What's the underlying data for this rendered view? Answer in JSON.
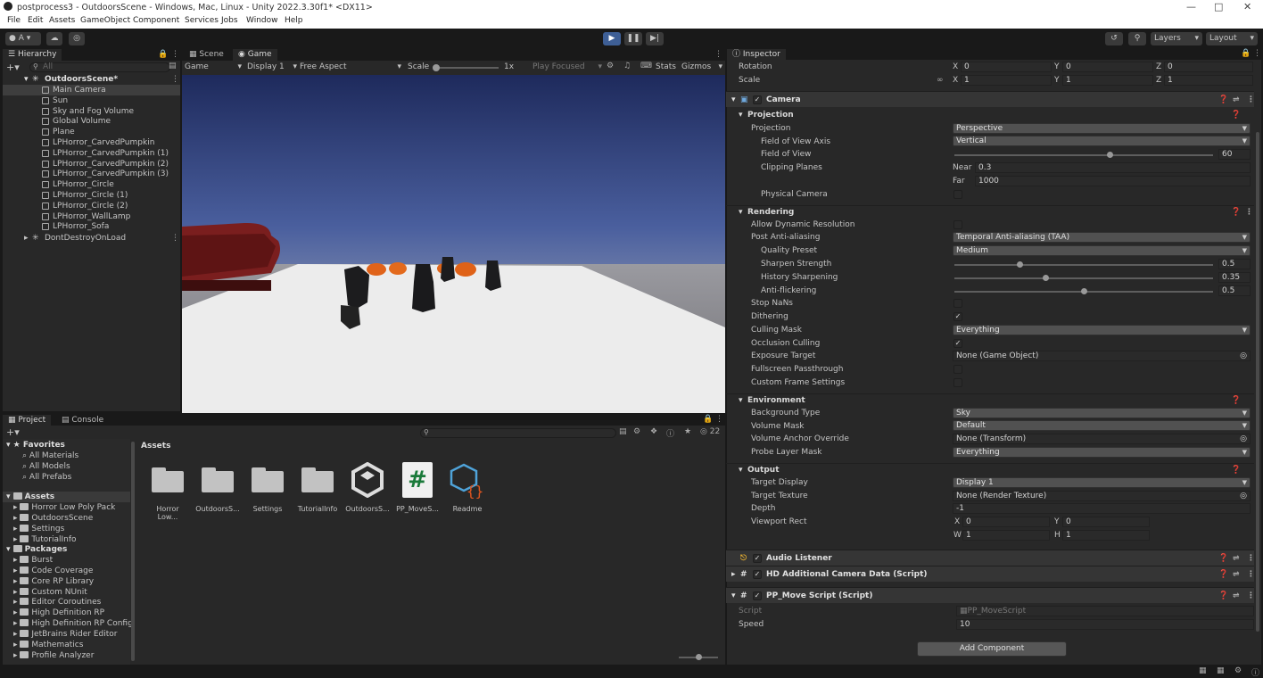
{
  "title_bar": {
    "title": "postprocess3 - OutdoorsScene - Windows, Mac, Linux - Unity 2022.3.30f1* <DX11>"
  },
  "menu": [
    "File",
    "Edit",
    "Assets",
    "GameObject",
    "Component",
    "Services",
    "Jobs",
    "Window",
    "Help"
  ],
  "toolbar": {
    "account": "A",
    "layers": "Layers",
    "layout": "Layout"
  },
  "hierarchy": {
    "tab": "Hierarchy",
    "search_placeholder": "All",
    "scene": "OutdoorsScene*",
    "items": [
      "Main Camera",
      "Sun",
      "Sky and Fog Volume",
      "Global Volume",
      "Plane",
      "LPHorror_CarvedPumpkin",
      "LPHorror_CarvedPumpkin (1)",
      "LPHorror_CarvedPumpkin (2)",
      "LPHorror_CarvedPumpkin (3)",
      "LPHorror_Circle",
      "LPHorror_Circle (1)",
      "LPHorror_Circle (2)",
      "LPHorror_WallLamp",
      "LPHorror_Sofa"
    ],
    "dont_destroy": "DontDestroyOnLoad"
  },
  "game_view": {
    "tabs": [
      "Scene",
      "Game"
    ],
    "mode": "Game",
    "display": "Display 1",
    "aspect": "Free Aspect",
    "scale_label": "Scale",
    "scale_value": "1x",
    "play_focused": "Play Focused",
    "stats": "Stats",
    "gizmos": "Gizmos",
    "scale_slider": 0.0
  },
  "project": {
    "tabs": [
      "Project",
      "Console"
    ],
    "hidden_count": "22",
    "favorites_label": "Favorites",
    "favorites": [
      "All Materials",
      "All Models",
      "All Prefabs"
    ],
    "assets_label": "Assets",
    "assets": [
      "Horror Low Poly Pack",
      "OutdoorsScene",
      "Settings",
      "TutorialInfo"
    ],
    "packages_label": "Packages",
    "packages": [
      "Burst",
      "Code Coverage",
      "Core RP Library",
      "Custom NUnit",
      "Editor Coroutines",
      "High Definition RP",
      "High Definition RP Config",
      "JetBrains Rider Editor",
      "Mathematics",
      "Profile Analyzer"
    ],
    "breadcrumb": "Assets",
    "grid_items": [
      "Horror Low...",
      "OutdoorsS...",
      "Settings",
      "TutorialInfo",
      "OutdoorsS...",
      "PP_MoveS...",
      "Readme"
    ]
  },
  "inspector": {
    "tab": "Inspector",
    "transform": {
      "rotation_label": "Rotation",
      "scale_label": "Scale",
      "rot": [
        "0",
        "0",
        "0"
      ],
      "scale": [
        "1",
        "1",
        "1"
      ]
    },
    "camera": {
      "title": "Camera",
      "projection_header": "Projection",
      "projection_label": "Projection",
      "projection_value": "Perspective",
      "fov_axis_label": "Field of View Axis",
      "fov_axis_value": "Vertical",
      "fov_label": "Field of View",
      "fov_value": "60",
      "fov_slider": 0.6,
      "clipping_label": "Clipping Planes",
      "near_label": "Near",
      "near_value": "0.3",
      "far_label": "Far",
      "far_value": "1000",
      "physical_label": "Physical Camera",
      "rendering_header": "Rendering",
      "dyn_res_label": "Allow Dynamic Resolution",
      "post_aa_label": "Post Anti-aliasing",
      "post_aa_value": "Temporal Anti-aliasing (TAA)",
      "quality_label": "Quality Preset",
      "quality_value": "Medium",
      "sharpen_label": "Sharpen Strength",
      "sharpen_value": "0.5",
      "sharpen_slider": 0.25,
      "history_label": "History Sharpening",
      "history_value": "0.35",
      "history_slider": 0.35,
      "flicker_label": "Anti-flickering",
      "flicker_value": "0.5",
      "flicker_slider": 0.5,
      "stop_nans_label": "Stop NaNs",
      "dithering_label": "Dithering",
      "culling_label": "Culling Mask",
      "culling_value": "Everything",
      "occlusion_label": "Occlusion Culling",
      "exposure_label": "Exposure Target",
      "exposure_value": "None (Game Object)",
      "fullscreen_label": "Fullscreen Passthrough",
      "custom_frame_label": "Custom Frame Settings",
      "environment_header": "Environment",
      "bg_label": "Background Type",
      "bg_value": "Sky",
      "volume_mask_label": "Volume Mask",
      "volume_mask_value": "Default",
      "anchor_label": "Volume Anchor Override",
      "anchor_value": "None (Transform)",
      "probe_label": "Probe Layer Mask",
      "probe_value": "Everything",
      "output_header": "Output",
      "target_display_label": "Target Display",
      "target_display_value": "Display 1",
      "target_texture_label": "Target Texture",
      "target_texture_value": "None (Render Texture)",
      "depth_label": "Depth",
      "depth_value": "-1",
      "viewport_label": "Viewport Rect",
      "vp_x": "0",
      "vp_y": "0",
      "vp_w": "1",
      "vp_h": "1"
    },
    "audio_listener": "Audio Listener",
    "hd_camera_data": "HD Additional Camera Data (Script)",
    "pp_move": {
      "title": "PP_Move Script (Script)",
      "script_label": "Script",
      "script_value": "PP_MoveScript",
      "speed_label": "Speed",
      "speed_value": "10"
    },
    "add_component": "Add Component"
  },
  "colors": {
    "editor_bg": "#282828",
    "accent_blue": "#3c5e8c",
    "play_button": "#3e5f96"
  }
}
